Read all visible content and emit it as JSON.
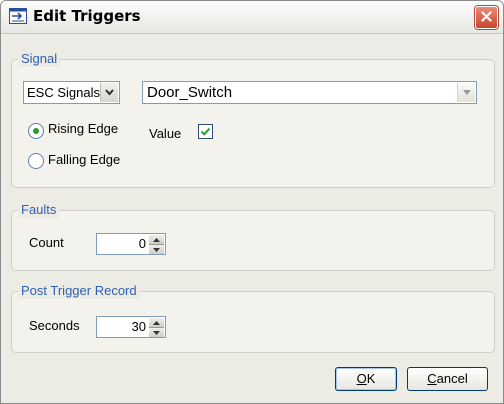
{
  "window": {
    "title": "Edit Triggers"
  },
  "signal": {
    "group_label": "Signal",
    "source_selected": "ESC Signals",
    "signal_selected": "Door_Switch",
    "rising_edge_label": "Rising Edge",
    "falling_edge_label": "Falling Edge",
    "selected_edge": "Rising Edge",
    "value_label": "Value",
    "value_checked": true
  },
  "faults": {
    "group_label": "Faults",
    "count_label": "Count",
    "count_value": "0"
  },
  "post_trigger": {
    "group_label": "Post Trigger Record",
    "seconds_label": "Seconds",
    "seconds_value": "30"
  },
  "buttons": {
    "ok_label": "OK",
    "ok_underline": "O",
    "ok_rest": "K",
    "cancel_label": "Cancel",
    "cancel_underline": "C",
    "cancel_rest": "ancel"
  },
  "icons": {
    "app": "edit-triggers-icon",
    "close": "close-icon",
    "dropdown": "chevron-down-icon",
    "spin_up": "spin-up-icon",
    "spin_down": "spin-down-icon",
    "check": "checkmark-icon"
  },
  "colors": {
    "group_title": "#2f5fb3",
    "close_button": "#c9452c",
    "radio_dot": "#2a9a2a",
    "check": "#2a9a2a"
  }
}
